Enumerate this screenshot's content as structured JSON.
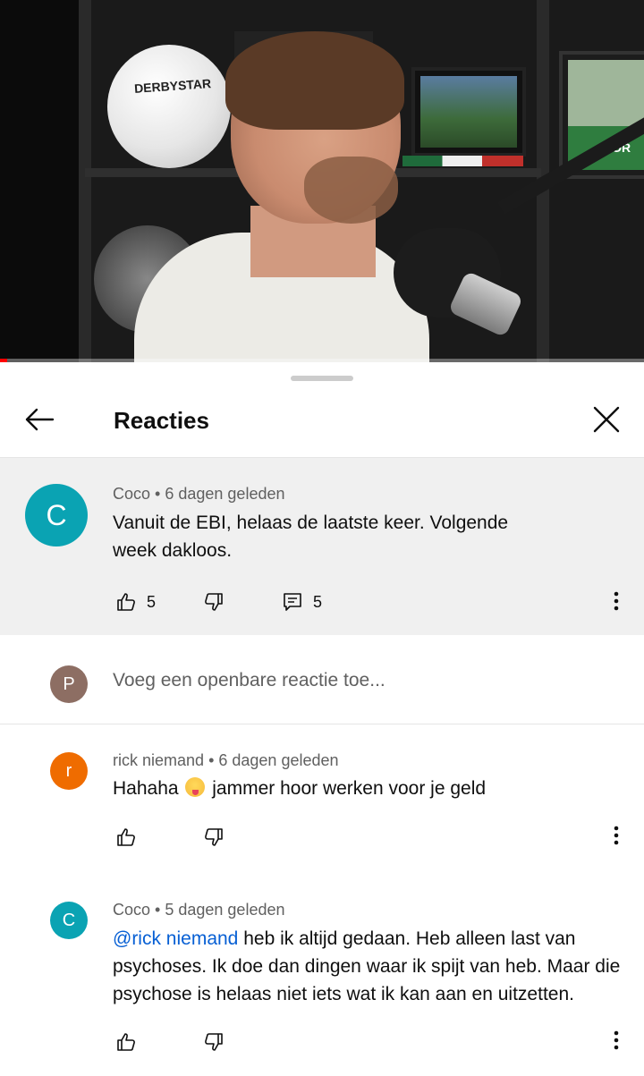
{
  "header": {
    "title": "Reacties"
  },
  "pinned_comment": {
    "avatar_letter": "C",
    "avatar_color": "#0aa3b3",
    "author": "Coco",
    "time": "6 dagen geleden",
    "text": "Vanuit de EBI, helaas de laatste keer. Volgende week dakloos.",
    "likes": "5",
    "replies": "5"
  },
  "input": {
    "avatar_letter": "P",
    "avatar_color": "#8d6e63",
    "placeholder": "Voeg een openbare reactie toe..."
  },
  "replies": [
    {
      "avatar_letter": "r",
      "avatar_color": "#ef6c00",
      "author": "rick niemand",
      "time": "6 dagen geleden",
      "text_before": "Hahaha",
      "emoji": "squinting-face-with-tongue",
      "text_after": "jammer hoor werken voor je geld"
    },
    {
      "avatar_letter": "C",
      "avatar_color": "#0aa3b3",
      "author": "Coco",
      "time": "5 dagen geleden",
      "mention": "@rick niemand",
      "text": "heb ik altijd gedaan. Heb alleen last van psychoses. Ik doe dan dingen waar ik spijt van heb. Maar die psychose is helaas niet iets wat ik kan aan en uitzetten."
    }
  ],
  "icons": {
    "back": "arrow-left-icon",
    "close": "close-icon",
    "like": "thumbs-up-icon",
    "dislike": "thumbs-down-icon",
    "reply": "comment-icon",
    "more": "more-vertical-icon"
  },
  "video_texts": {
    "ball_brand": "DERBYSTAR",
    "frame_text": "COR"
  }
}
